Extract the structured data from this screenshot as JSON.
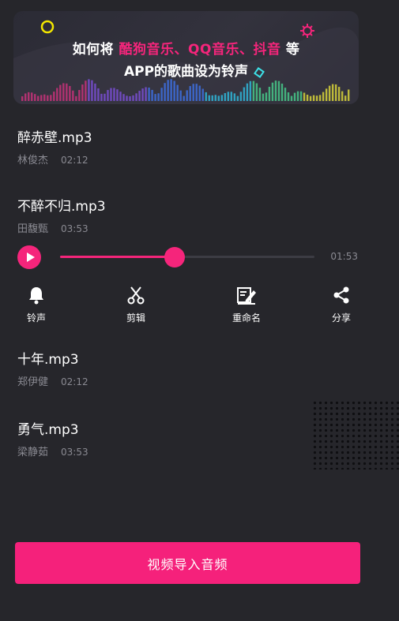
{
  "banner": {
    "line1_pre": "如何将",
    "line1_hl": "酷狗音乐、QQ音乐、抖音",
    "line1_post": "等",
    "line2": "APP的歌曲设为铃声"
  },
  "songs": [
    {
      "title": "醉赤壁.mp3",
      "artist": "林俊杰",
      "duration": "02:12"
    },
    {
      "title": "不醉不归.mp3",
      "artist": "田馥甄",
      "duration": "03:53"
    },
    {
      "title": "十年.mp3",
      "artist": "郑伊健",
      "duration": "02:12"
    },
    {
      "title": "勇气.mp3",
      "artist": "梁静茹",
      "duration": "03:53"
    }
  ],
  "player": {
    "time": "01:53",
    "progress": 0.45
  },
  "actions": [
    {
      "label": "铃声",
      "icon": "bell-icon"
    },
    {
      "label": "剪辑",
      "icon": "scissors-icon"
    },
    {
      "label": "重命名",
      "icon": "rename-icon"
    },
    {
      "label": "分享",
      "icon": "share-icon"
    }
  ],
  "cta": {
    "label": "视频导入音频"
  },
  "colors": {
    "accent": "#f5257b",
    "background": "#26262b",
    "muted": "#8a8a92"
  }
}
